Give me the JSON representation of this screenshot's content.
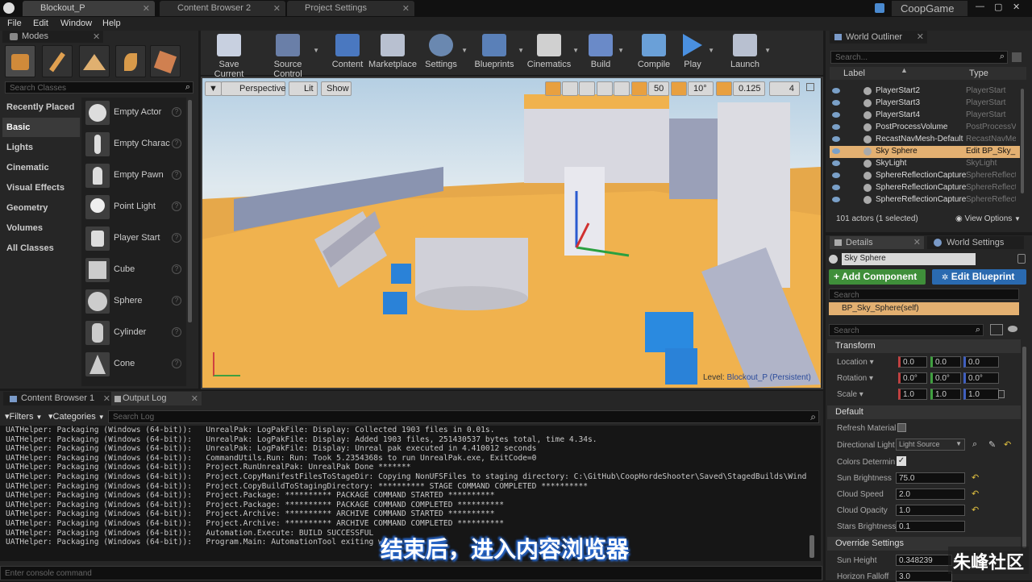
{
  "titlebar": {
    "tabs": [
      "Blockout_P",
      "Content Browser 2",
      "Project Settings"
    ],
    "project": "CoopGame"
  },
  "menu": [
    "File",
    "Edit",
    "Window",
    "Help"
  ],
  "modes": {
    "title": "Modes",
    "search_placeholder": "Search Classes",
    "categories": [
      "Recently Placed",
      "Basic",
      "Lights",
      "Cinematic",
      "Visual Effects",
      "Geometry",
      "Volumes",
      "All Classes"
    ],
    "items": [
      "Empty Actor",
      "Empty Charac",
      "Empty Pawn",
      "Point Light",
      "Player Start",
      "Cube",
      "Sphere",
      "Cylinder",
      "Cone"
    ]
  },
  "toolbar": [
    "Save Current",
    "Source Control",
    "Content",
    "Marketplace",
    "Settings",
    "Blueprints",
    "Cinematics",
    "Build",
    "Compile",
    "Play",
    "Launch"
  ],
  "viewport": {
    "perspective": "Perspective",
    "lit": "Lit",
    "show": "Show",
    "grid_snap": "50",
    "rot_snap": "10°",
    "scale_snap": "0.125",
    "cam_speed": "4",
    "level_label": "Level:",
    "level_name": "Blockout_P (Persistent)"
  },
  "outliner": {
    "title": "World Outliner",
    "search_placeholder": "Search...",
    "col_label": "Label",
    "col_type": "Type",
    "rows": [
      {
        "name": "PlayerStart2",
        "type": "PlayerStart"
      },
      {
        "name": "PlayerStart3",
        "type": "PlayerStart"
      },
      {
        "name": "PlayerStart4",
        "type": "PlayerStart"
      },
      {
        "name": "PostProcessVolume",
        "type": "PostProcessV"
      },
      {
        "name": "RecastNavMesh-Default",
        "type": "RecastNavMe"
      },
      {
        "name": "Sky Sphere",
        "type": "Edit BP_Sky_"
      },
      {
        "name": "SkyLight",
        "type": "SkyLight"
      },
      {
        "name": "SphereReflectionCapture",
        "type": "SphereReflect"
      },
      {
        "name": "SphereReflectionCapture",
        "type": "SphereReflect"
      },
      {
        "name": "SphereReflectionCapture",
        "type": "SphereReflect"
      }
    ],
    "count": "101 actors (1 selected)",
    "view_options": "View Options"
  },
  "details": {
    "tab1": "Details",
    "tab2": "World Settings",
    "actor_name": "Sky Sphere",
    "add_component": "+ Add Component",
    "edit_blueprint": "Edit Blueprint",
    "search_placeholder": "Search",
    "component": "BP_Sky_Sphere(self)",
    "transform": "Transform",
    "location": "Location",
    "rotation": "Rotation",
    "scale": "Scale",
    "loc": [
      "0.0",
      "0.0",
      "0.0"
    ],
    "rot": [
      "0.0°",
      "0.0°",
      "0.0°"
    ],
    "scl": [
      "1.0",
      "1.0",
      "1.0"
    ],
    "default": "Default",
    "refresh_material": "Refresh Material",
    "directional_light": "Directional Light",
    "directional_light_value": "Light Source",
    "colors_determined": "Colors Determin",
    "sun_brightness": "Sun Brightness",
    "sun_brightness_val": "75.0",
    "cloud_speed": "Cloud Speed",
    "cloud_speed_val": "2.0",
    "cloud_opacity": "Cloud Opacity",
    "cloud_opacity_val": "1.0",
    "stars_brightness": "Stars Brightness",
    "stars_brightness_val": "0.1",
    "override": "Override Settings",
    "sun_height": "Sun Height",
    "sun_height_val": "0.348239",
    "horizon_falloff": "Horizon Falloff",
    "horizon_falloff_val": "3.0"
  },
  "bottom": {
    "tab1": "Content Browser 1",
    "tab2": "Output Log",
    "filters": "Filters",
    "categories": "Categories",
    "search_placeholder": "Search Log",
    "console_placeholder": "Enter console command",
    "log_lines": [
      "UATHelper: Packaging (Windows (64-bit)):   UnrealPak: LogPakFile: Display: Collected 1903 files in 0.01s.",
      "UATHelper: Packaging (Windows (64-bit)):   UnrealPak: LogPakFile: Display: Added 1903 files, 251430537 bytes total, time 4.34s.",
      "UATHelper: Packaging (Windows (64-bit)):   UnrealPak: LogPakFile: Display: Unreal pak executed in 4.410012 seconds",
      "UATHelper: Packaging (Windows (64-bit)):   CommandUtils.Run: Run: Took 5.2354368s to run UnrealPak.exe, ExitCode=0",
      "UATHelper: Packaging (Windows (64-bit)):   Project.RunUnrealPak: UnrealPak Done *******",
      "UATHelper: Packaging (Windows (64-bit)):   Project.CopyManifestFilesToStageDir: Copying NonUFSFiles to staging directory: C:\\GitHub\\CoopHordeShooter\\Saved\\StagedBuilds\\Wind",
      "UATHelper: Packaging (Windows (64-bit)):   Project.CopyBuildToStagingDirectory: ********** STAGE COMMAND COMPLETED **********",
      "UATHelper: Packaging (Windows (64-bit)):   Project.Package: ********** PACKAGE COMMAND STARTED **********",
      "UATHelper: Packaging (Windows (64-bit)):   Project.Package: ********** PACKAGE COMMAND COMPLETED **********",
      "UATHelper: Packaging (Windows (64-bit)):   Project.Archive: ********** ARCHIVE COMMAND STARTED **********",
      "UATHelper: Packaging (Windows (64-bit)):   Project.Archive: ********** ARCHIVE COMMAND COMPLETED **********",
      "UATHelper: Packaging (Windows (64-bit)):   Automation.Execute: BUILD SUCCESSFUL",
      "UATHelper: Packaging (Windows (64-bit)):   Program.Main: AutomationTool exiting w"
    ]
  },
  "subtitle": "结束后，进入内容浏览器",
  "watermark": "朱峰社区"
}
